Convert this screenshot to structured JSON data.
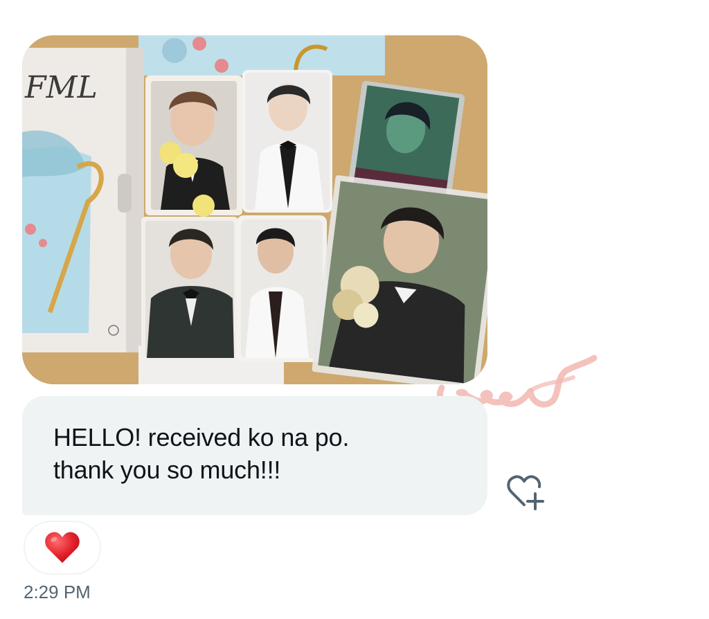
{
  "photo": {
    "alt": "Photo of album box and photocards",
    "album_logo": "FML",
    "accent_colors": {
      "table": "#c9a368",
      "box": "#eeeae6",
      "card_blue": "#b9dbe9"
    }
  },
  "message": {
    "line1": "HELLO! received ko na po.",
    "line2": "thank you so much!!!"
  },
  "actions": {
    "react_icon": "heart-plus-icon"
  },
  "reaction": {
    "emoji": "❤️",
    "icon": "red-heart-icon"
  },
  "timestamp": "2:29 PM",
  "watermark": {
    "icon": "scribble-watermark",
    "color": "#f2b7b0"
  }
}
